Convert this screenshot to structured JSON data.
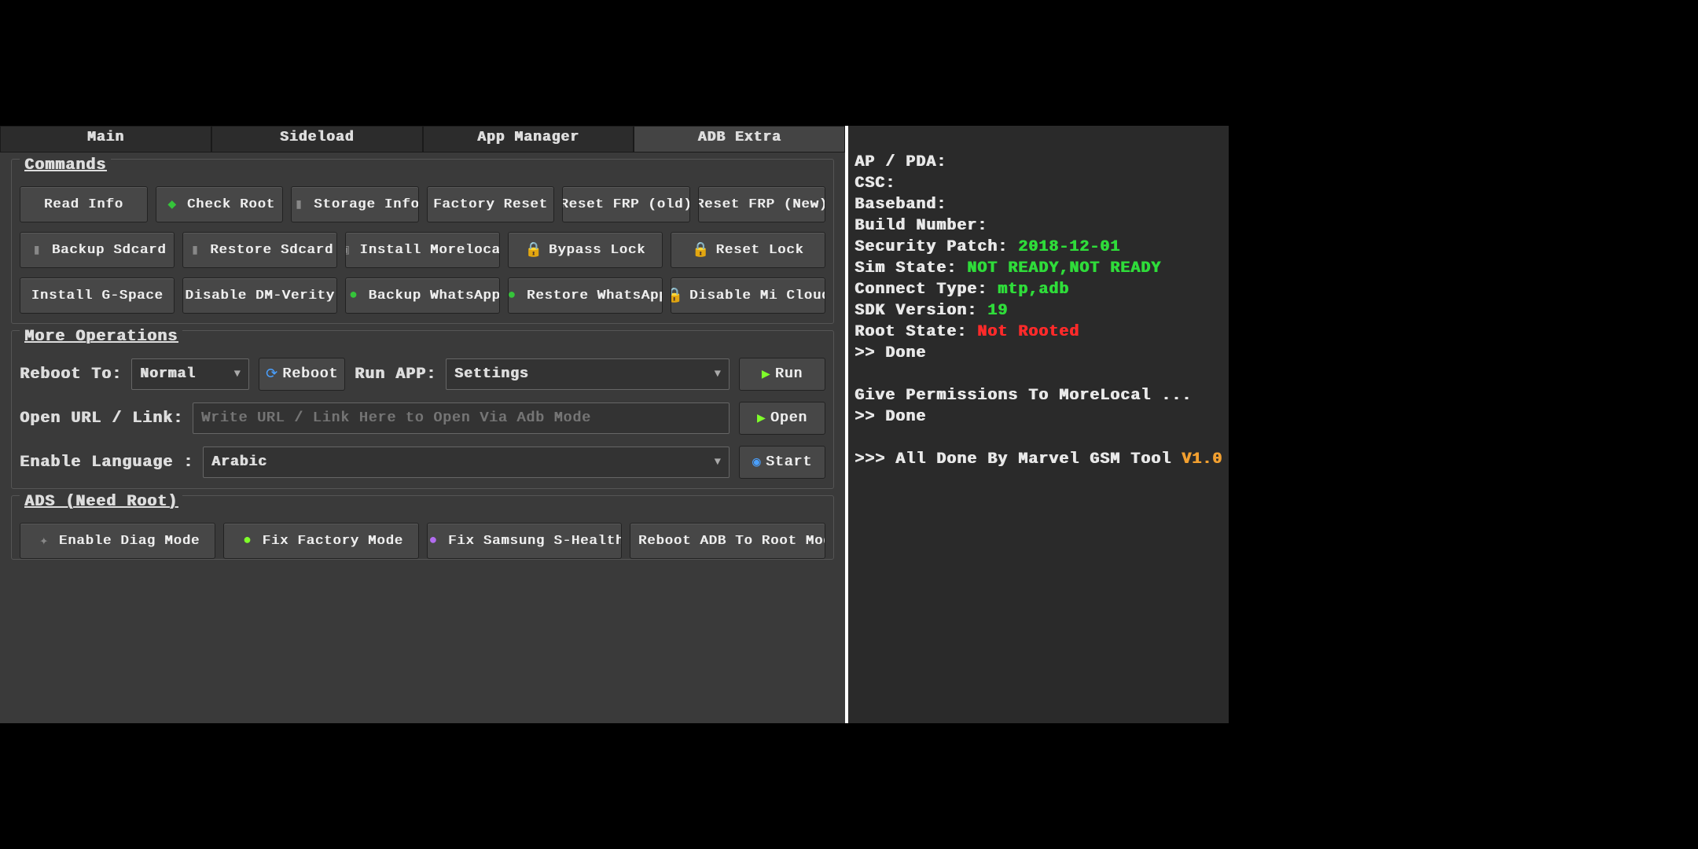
{
  "tabs": {
    "main": "Main",
    "sideload": "Sideload",
    "appmgr": "App Manager",
    "adbextra": "ADB Extra"
  },
  "groups": {
    "commands": "Commands",
    "moreops": "More Operations",
    "ads": "ADS (Need Root)"
  },
  "cmd": {
    "read_info": "Read Info",
    "check_root": "Check Root",
    "storage_info": "Storage Info",
    "factory_reset": "Factory Reset",
    "reset_frp_old": "Reset FRP (old)",
    "reset_frp_new": "Reset FRP (New)",
    "backup_sdcard": "Backup Sdcard",
    "restore_sdcard": "Restore Sdcard",
    "install_morelocal": "Install Morelocal",
    "bypass_lock": "Bypass Lock",
    "reset_lock": "Reset Lock",
    "install_gspace": "Install G-Space",
    "disable_dmverity": "Disable DM-Verity",
    "backup_whatsapp": "Backup WhatsApp",
    "restore_whatsapp": "Restore WhatsApp",
    "disable_micloud": "Disable Mi Cloud"
  },
  "more": {
    "reboot_to_lbl": "Reboot To:",
    "reboot_to_val": "Normal",
    "reboot_btn": "Reboot",
    "run_app_lbl": "Run APP:",
    "run_app_val": "Settings",
    "run_btn": "Run",
    "open_url_lbl": "Open URL / Link:",
    "open_url_ph": "Write URL / Link Here to Open Via Adb Mode",
    "open_btn": "Open",
    "enable_lang_lbl": "Enable Language :",
    "enable_lang_val": "Arabic",
    "start_btn": "Start"
  },
  "ads": {
    "enable_diag": "Enable Diag Mode",
    "fix_factory": "Fix Factory Mode",
    "fix_samsung": "Fix Samsung S-Health",
    "reboot_adb": "Reboot ADB To Root Mode"
  },
  "log": {
    "l1a": "AP / PDA:",
    "l2a": "CSC:",
    "l3a": "Baseband:",
    "l4a": "Build Number:",
    "l5a": "Security Patch:",
    "l5b": "2018-12-01",
    "l6a": "Sim State:",
    "l6b": "NOT READY,NOT READY",
    "l7a": "Connect Type:",
    "l7b": "mtp,adb",
    "l8a": "SDK Version:",
    "l8b": "19",
    "l9a": "Root State:",
    "l9b": "Not Rooted",
    "l10": ">> Done",
    "l11": "Give Permissions To MoreLocal ...",
    "l12": ">> Done",
    "l13a": ">>> All Done By Marvel GSM Tool ",
    "l13b": "V1.0"
  }
}
